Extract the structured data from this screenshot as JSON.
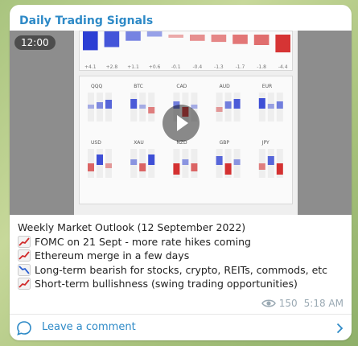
{
  "channel": {
    "name": "Daily Trading Signals"
  },
  "video": {
    "duration": "12:00",
    "play_icon": "play-icon",
    "thumbnail_row_values": [
      "+4.1",
      "+2.8",
      "+1.1",
      "+0.6",
      "-0.1",
      "-0.4",
      "-1.3",
      "-1.7",
      "-1.8",
      "-4.4"
    ],
    "thumbnail_row_levels": [
      0.9,
      0.75,
      0.45,
      0.25,
      -0.15,
      -0.3,
      -0.35,
      -0.45,
      -0.5,
      -0.85
    ],
    "thumbnail_labels": [
      "QQQ",
      "BTC",
      "CAD",
      "AUD",
      "EUR",
      "USD",
      "XAU",
      "NZD",
      "GBP",
      "JPY"
    ]
  },
  "post": {
    "title": "Weekly Market Outlook (12 September 2022)",
    "lines": [
      {
        "text": "FOMC on 21 Sept - more rate hikes coming",
        "icon": "chart-increasing-icon"
      },
      {
        "text": "Ethereum merge in a few days",
        "icon": "chart-increasing-icon"
      },
      {
        "text": "Long-term bearish for stocks, crypto, REITs, commods, etc",
        "icon": "chart-decreasing-icon"
      },
      {
        "text": "Short-term bullishness (swing trading opportunities)",
        "icon": "chart-increasing-icon"
      }
    ],
    "views": "150",
    "time": "5:18 AM"
  },
  "comments": {
    "label": "Leave a comment"
  },
  "colors": {
    "accent": "#2e8ac7",
    "meta": "#9aa9b3",
    "up": "#1a2fd1",
    "down": "#d11a1a"
  }
}
